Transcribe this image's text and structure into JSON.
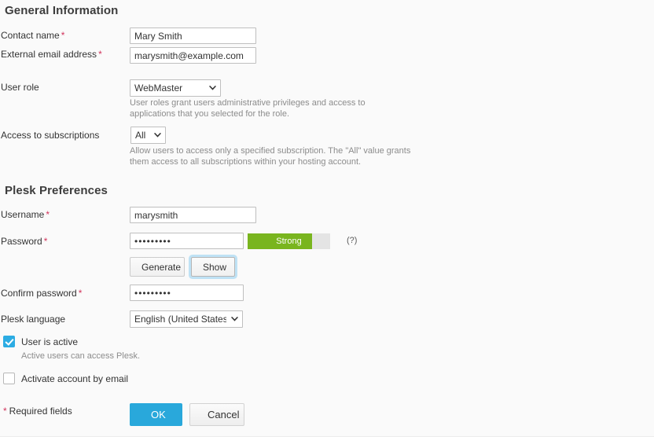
{
  "sections": {
    "general": {
      "title": "General Information",
      "fields": {
        "contact_name": {
          "label": "Contact name",
          "required_mark": "*",
          "value": "Mary Smith"
        },
        "external_email": {
          "label": "External email address",
          "required_mark": "*",
          "value": "marysmith@example.com"
        },
        "user_role": {
          "label": "User role",
          "value": "WebMaster",
          "options": [
            "WebMaster"
          ],
          "hint": "User roles grant users administrative privileges and access to applications that you selected for the role."
        },
        "access_subscriptions": {
          "label": "Access to subscriptions",
          "value": "All",
          "options": [
            "All"
          ],
          "hint": "Allow users to access only a specified subscription. The \"All\" value grants them access to all subscriptions within your hosting account."
        }
      }
    },
    "plesk": {
      "title": "Plesk Preferences",
      "fields": {
        "username": {
          "label": "Username",
          "required_mark": "*",
          "value": "marysmith"
        },
        "password": {
          "label": "Password",
          "required_mark": "*",
          "value": "•••••••••",
          "strength_label": "Strong",
          "strength_percent": 78,
          "strength_color": "#79b51e",
          "help_label": "(?)",
          "generate_label": "Generate",
          "show_label": "Show"
        },
        "confirm_password": {
          "label": "Confirm password",
          "required_mark": "*",
          "value": "•••••••••"
        },
        "language": {
          "label": "Plesk language",
          "value": "English (United States)",
          "options": [
            "English (United States)"
          ]
        },
        "user_active": {
          "label": "User is active",
          "checked": true,
          "hint": "Active users can access Plesk."
        },
        "activate_by_email": {
          "label": "Activate account by email",
          "checked": false
        }
      }
    }
  },
  "footer": {
    "required_note_mark": "*",
    "required_note": "Required fields",
    "ok_label": "OK",
    "cancel_label": "Cancel"
  },
  "colors": {
    "accent": "#29a8db",
    "required": "#d1335b",
    "strength_green": "#79b51e",
    "background": "#fafafa"
  }
}
